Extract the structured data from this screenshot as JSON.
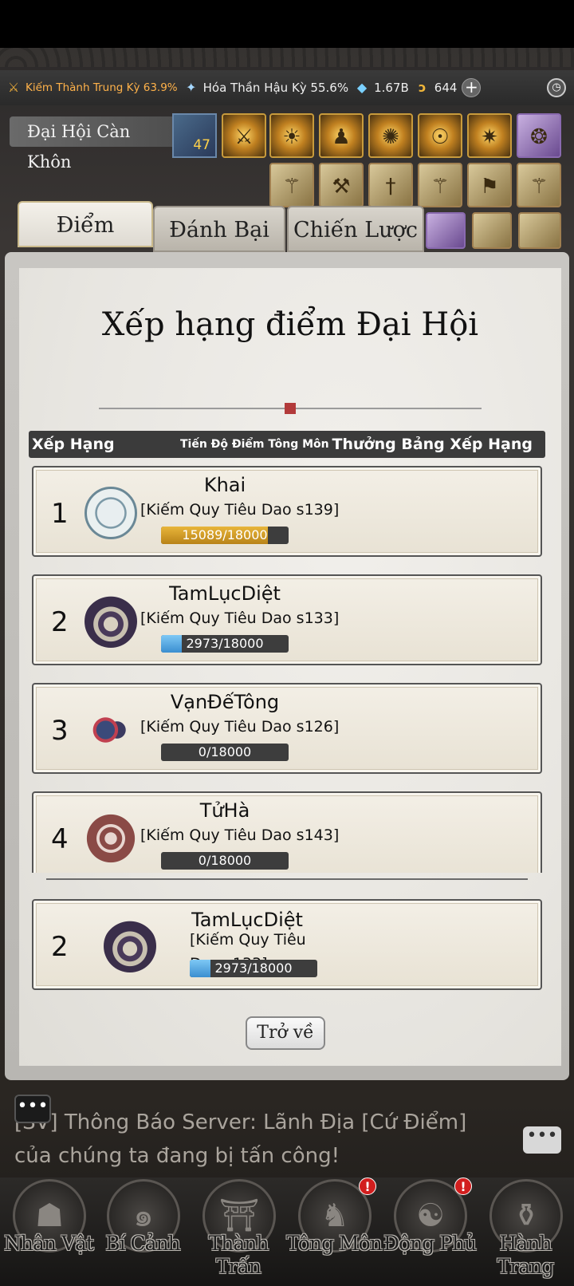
{
  "resources": {
    "cultivation_sword": "Kiếm Thành Trung Kỳ 63.9%",
    "cultivation_fan": "Hóa Thần Hậu Kỳ 55.6%",
    "crystals": "1.67B",
    "coins": "644",
    "plus": "+"
  },
  "event": {
    "name": "Đại Hội Càn Khôn",
    "level": "47"
  },
  "tabs": [
    {
      "label": "Điểm",
      "active": true
    },
    {
      "label": "Đánh Bại",
      "active": false
    },
    {
      "label": "Chiến Lược",
      "active": false
    }
  ],
  "panel": {
    "title": "Xếp hạng điểm Đại Hội",
    "headers": {
      "rank": "Xếp Hạng",
      "progress": "Tiến Độ Điểm Tông Môn",
      "reward": "Thưởng Bảng Xếp Hạng"
    }
  },
  "rankings": [
    {
      "rank": "1",
      "name": "Khai",
      "server": "[Kiếm Quy Tiêu Dao s139]",
      "score": "15089/18000",
      "progress": 0.838,
      "bar_color": "gold"
    },
    {
      "rank": "2",
      "name": "TamLụcDiệt",
      "server": "[Kiếm Quy Tiêu Dao s133]",
      "score": "2973/18000",
      "progress": 0.165,
      "bar_color": "blue"
    },
    {
      "rank": "3",
      "name": "VạnĐếTông",
      "server": "[Kiếm Quy Tiêu Dao s126]",
      "score": "0/18000",
      "progress": 0,
      "bar_color": "blue"
    },
    {
      "rank": "4",
      "name": "TửHà",
      "server": "[Kiếm Quy Tiêu Dao s143]",
      "score": "0/18000",
      "progress": 0,
      "bar_color": "blue"
    }
  ],
  "my_rank": {
    "rank": "2",
    "name": "TamLụcDiệt",
    "server": "[Kiếm Quy Tiêu Dao s133]",
    "score": "2973/18000",
    "progress": 0.165
  },
  "back_button": "Trở về",
  "chat": {
    "message": "[SV] Thông Báo Server: Lãnh Địa [Cứ Điểm] của chúng ta đang bị tấn công!"
  },
  "nav": [
    {
      "label": "Nhân Vật",
      "icon": "character-icon",
      "badge": false
    },
    {
      "label": "Bí Cảnh",
      "icon": "secret-realm-icon",
      "badge": false
    },
    {
      "label": "Thành Trấn",
      "icon": "town-icon",
      "badge": false
    },
    {
      "label": "Tông Môn",
      "icon": "sect-icon",
      "badge": true
    },
    {
      "label": "Động Phủ",
      "icon": "cave-icon",
      "badge": true
    },
    {
      "label": "Hành Trang",
      "icon": "bag-icon",
      "badge": false
    }
  ]
}
